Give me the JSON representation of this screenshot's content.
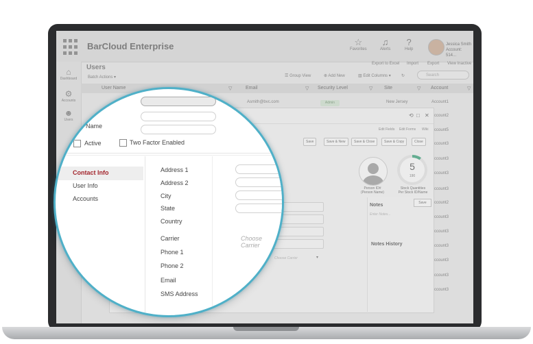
{
  "app": {
    "title": "BarCloud Enterprise",
    "header_items": [
      {
        "label": "Favorites",
        "icon": "star-icon"
      },
      {
        "label": "Alerts",
        "icon": "bell-icon"
      },
      {
        "label": "Help",
        "icon": "question-icon"
      }
    ],
    "user": {
      "name": "Jessica Smith",
      "account": "Account: 514..."
    }
  },
  "sidebar": {
    "items": [
      {
        "label": "Dashboard",
        "icon": "home-icon"
      },
      {
        "label": "Accounts",
        "icon": "gear-icon"
      },
      {
        "label": "Users",
        "icon": "users-icon"
      }
    ]
  },
  "page": {
    "title": "Users",
    "batch_actions": "Batch Actions",
    "top_links": [
      "Export to Excel",
      "Import",
      "Export",
      "View Inactive"
    ],
    "toolbar": {
      "group_view": "Group View",
      "add_new": "Add New",
      "edit_columns": "Edit Columns",
      "search_placeholder": "Search"
    }
  },
  "table": {
    "headers": [
      "User Name",
      "Email",
      "Security Level",
      "Site",
      "Account"
    ],
    "row1": {
      "email": "Asmith@bvc.com",
      "security": "Admin",
      "site": "New Jersey"
    },
    "accounts": [
      "Account1",
      "Account2",
      "Account5",
      "Account3",
      "Account3",
      "Account3",
      "Account3",
      "Account2",
      "Account3",
      "Account3",
      "Account3",
      "Account3",
      "Account3",
      "Account3"
    ]
  },
  "form": {
    "edit_links": [
      "Edit Fields",
      "Edit Forms",
      "Wiki"
    ],
    "buttons": [
      "Save",
      "Save & New",
      "Save & Close",
      "Save & Copy",
      "Close"
    ],
    "person_id_label": "Person ID#",
    "person_name_label": "(Person Name)",
    "stock": {
      "value": "5",
      "sub": "190",
      "label": "Stock Quantities",
      "sublabel": "Per Stock ID/Name",
      "fraction": 0.1
    },
    "notes": {
      "title": "Notes",
      "save": "Save",
      "placeholder": "Enter Notes...",
      "history": "Notes History"
    },
    "bg_choose_carrier": "Choose Carrier"
  },
  "zoom": {
    "name_label": "Name",
    "active_label": "Active",
    "two_factor_label": "Two Factor Enabled",
    "nav": [
      "Contact Info",
      "User Info",
      "Accounts"
    ],
    "fields": [
      "Address 1",
      "Address 2",
      "City",
      "State",
      "Country",
      "Carrier",
      "Phone 1",
      "Phone 2",
      "Email",
      "SMS Address"
    ],
    "carrier_placeholder": "Choose Carrier"
  }
}
